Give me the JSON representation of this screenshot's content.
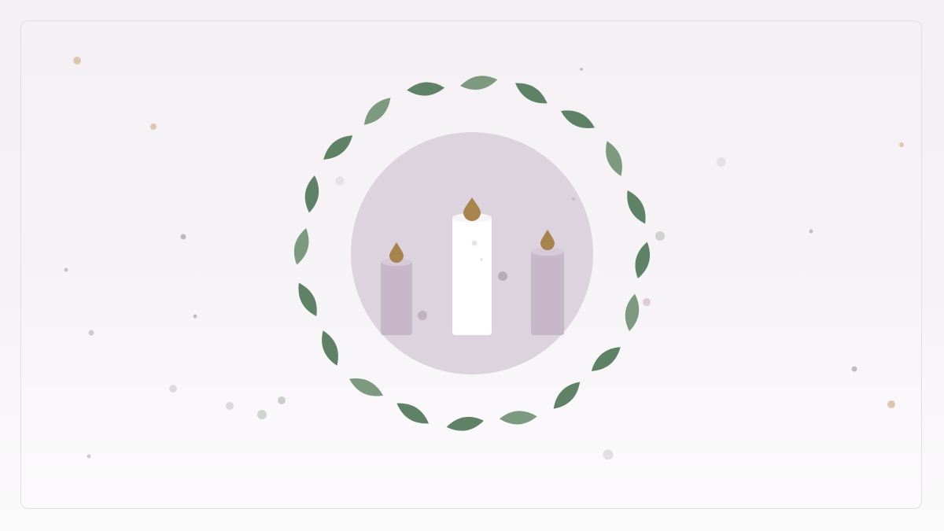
{
  "colors": {
    "background": "#f4f0f4",
    "card_border": "#e2dde2",
    "disc": "#ddd3de",
    "leaf_dark": "#5f8266",
    "leaf_light": "#7d9a80",
    "side_candle": "#c7b7c9",
    "side_candle_top": "#d8cbda",
    "center_candle": "#ffffff",
    "flame": "#a7834e",
    "dot_grey": "#c9c6c9",
    "dot_tan": "#d9c4ad",
    "dot_mauve": "#d8c6d3",
    "dot_sage": "#c3ccc3"
  },
  "icons": {
    "wreath": "advent-wreath-icon",
    "candles": "three-candles-icon",
    "flame": "flame-icon"
  },
  "candles": {
    "count": 3,
    "lit": 3
  }
}
